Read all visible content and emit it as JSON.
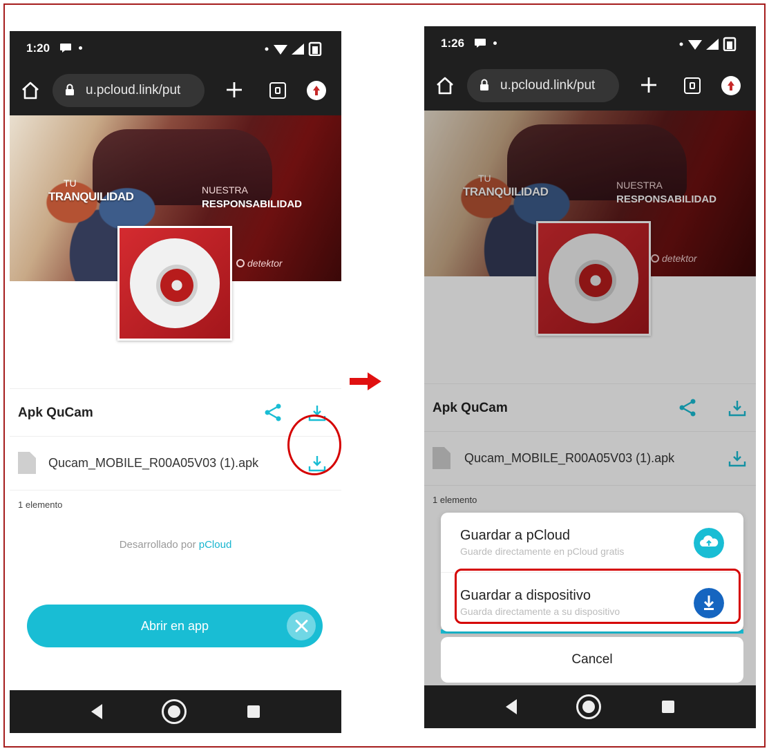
{
  "colors": {
    "accent": "#19bdd4",
    "highlight": "#d50000",
    "app_red": "#c62828",
    "save_device_blue": "#1565c0"
  },
  "left_phone": {
    "status": {
      "time": "1:20"
    },
    "browser": {
      "url": "u.pcloud.link/put"
    },
    "banner": {
      "line1": "TU",
      "line2": "TRANQUILIDAD",
      "line3": "NUESTRA",
      "line4": "RESPONSABILIDAD",
      "brand": "detektor"
    },
    "file_title": "Apk QuCam",
    "file_name": "Qucam_MOBILE_R00A05V03 (1).apk",
    "item_count": "1 elemento",
    "powered": {
      "prefix": "Desarrollado por ",
      "link": "pCloud"
    },
    "open_app": "Abrir en app"
  },
  "right_phone": {
    "status": {
      "time": "1:26"
    },
    "browser": {
      "url": "u.pcloud.link/put"
    },
    "banner": {
      "line1": "TU",
      "line2": "TRANQUILIDAD",
      "line3": "NUESTRA",
      "line4": "RESPONSABILIDAD",
      "brand": "detektor"
    },
    "file_title": "Apk QuCam",
    "file_name": "Qucam_MOBILE_R00A05V03 (1).apk",
    "item_count": "1 elemento",
    "sheet": {
      "options": [
        {
          "title": "Guardar a pCloud",
          "subtitle": "Guarde directamente en pCloud gratis",
          "icon": "cloud-upload-icon"
        },
        {
          "title": "Guardar a dispositivo",
          "subtitle": "Guarda directamente a su dispositivo",
          "icon": "download-circle-icon"
        }
      ],
      "cancel": "Cancel"
    }
  }
}
